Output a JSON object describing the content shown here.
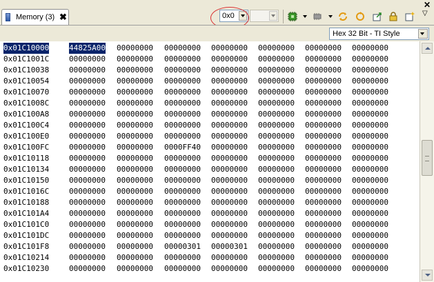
{
  "tab": {
    "label": "Memory (3)",
    "close_glyph": "✖"
  },
  "toolbar": {
    "address_value": "0x0",
    "second_combo_value": "",
    "icons": [
      "connect-icon",
      "chip-icon",
      "refresh-icon",
      "sync-icon",
      "import-icon",
      "lock-icon",
      "new-view-icon"
    ],
    "window_close_glyph": "✕",
    "view_menu_glyph": "▽",
    "accent_circle_color": "#d93030"
  },
  "format": {
    "selected": "Hex 32 Bit - TI Style"
  },
  "memory": {
    "rows": [
      {
        "address": "0x01C10000",
        "values": [
          "44825A00",
          "00000000",
          "00000000",
          "00000000",
          "00000000",
          "00000000",
          "00000000"
        ]
      },
      {
        "address": "0x01C1001C",
        "values": [
          "00000000",
          "00000000",
          "00000000",
          "00000000",
          "00000000",
          "00000000",
          "00000000"
        ]
      },
      {
        "address": "0x01C10038",
        "values": [
          "00000000",
          "00000000",
          "00000000",
          "00000000",
          "00000000",
          "00000000",
          "00000000"
        ]
      },
      {
        "address": "0x01C10054",
        "values": [
          "00000000",
          "00000000",
          "00000000",
          "00000000",
          "00000000",
          "00000000",
          "00000000"
        ]
      },
      {
        "address": "0x01C10070",
        "values": [
          "00000000",
          "00000000",
          "00000000",
          "00000000",
          "00000000",
          "00000000",
          "00000000"
        ]
      },
      {
        "address": "0x01C1008C",
        "values": [
          "00000000",
          "00000000",
          "00000000",
          "00000000",
          "00000000",
          "00000000",
          "00000000"
        ]
      },
      {
        "address": "0x01C100A8",
        "values": [
          "00000000",
          "00000000",
          "00000000",
          "00000000",
          "00000000",
          "00000000",
          "00000000"
        ]
      },
      {
        "address": "0x01C100C4",
        "values": [
          "00000000",
          "00000000",
          "00000000",
          "00000000",
          "00000000",
          "00000000",
          "00000000"
        ]
      },
      {
        "address": "0x01C100E0",
        "values": [
          "00000000",
          "00000000",
          "00000000",
          "00000000",
          "00000000",
          "00000000",
          "00000000"
        ]
      },
      {
        "address": "0x01C100FC",
        "values": [
          "00000000",
          "00000000",
          "0000FF40",
          "00000000",
          "00000000",
          "00000000",
          "00000000"
        ]
      },
      {
        "address": "0x01C10118",
        "values": [
          "00000000",
          "00000000",
          "00000000",
          "00000000",
          "00000000",
          "00000000",
          "00000000"
        ]
      },
      {
        "address": "0x01C10134",
        "values": [
          "00000000",
          "00000000",
          "00000000",
          "00000000",
          "00000000",
          "00000000",
          "00000000"
        ]
      },
      {
        "address": "0x01C10150",
        "values": [
          "00000000",
          "00000000",
          "00000000",
          "00000000",
          "00000000",
          "00000000",
          "00000000"
        ]
      },
      {
        "address": "0x01C1016C",
        "values": [
          "00000000",
          "00000000",
          "00000000",
          "00000000",
          "00000000",
          "00000000",
          "00000000"
        ]
      },
      {
        "address": "0x01C10188",
        "values": [
          "00000000",
          "00000000",
          "00000000",
          "00000000",
          "00000000",
          "00000000",
          "00000000"
        ]
      },
      {
        "address": "0x01C101A4",
        "values": [
          "00000000",
          "00000000",
          "00000000",
          "00000000",
          "00000000",
          "00000000",
          "00000000"
        ]
      },
      {
        "address": "0x01C101C0",
        "values": [
          "00000000",
          "00000000",
          "00000000",
          "00000000",
          "00000000",
          "00000000",
          "00000000"
        ]
      },
      {
        "address": "0x01C101DC",
        "values": [
          "00000000",
          "00000000",
          "00000000",
          "00000000",
          "00000000",
          "00000000",
          "00000000"
        ]
      },
      {
        "address": "0x01C101F8",
        "values": [
          "00000000",
          "00000000",
          "00000301",
          "00000301",
          "00000000",
          "00000000",
          "00000000"
        ]
      },
      {
        "address": "0x01C10214",
        "values": [
          "00000000",
          "00000000",
          "00000000",
          "00000000",
          "00000000",
          "00000000",
          "00000000"
        ]
      },
      {
        "address": "0x01C10230",
        "values": [
          "00000000",
          "00000000",
          "00000000",
          "00000000",
          "00000000",
          "00000000",
          "00000000"
        ]
      }
    ]
  }
}
